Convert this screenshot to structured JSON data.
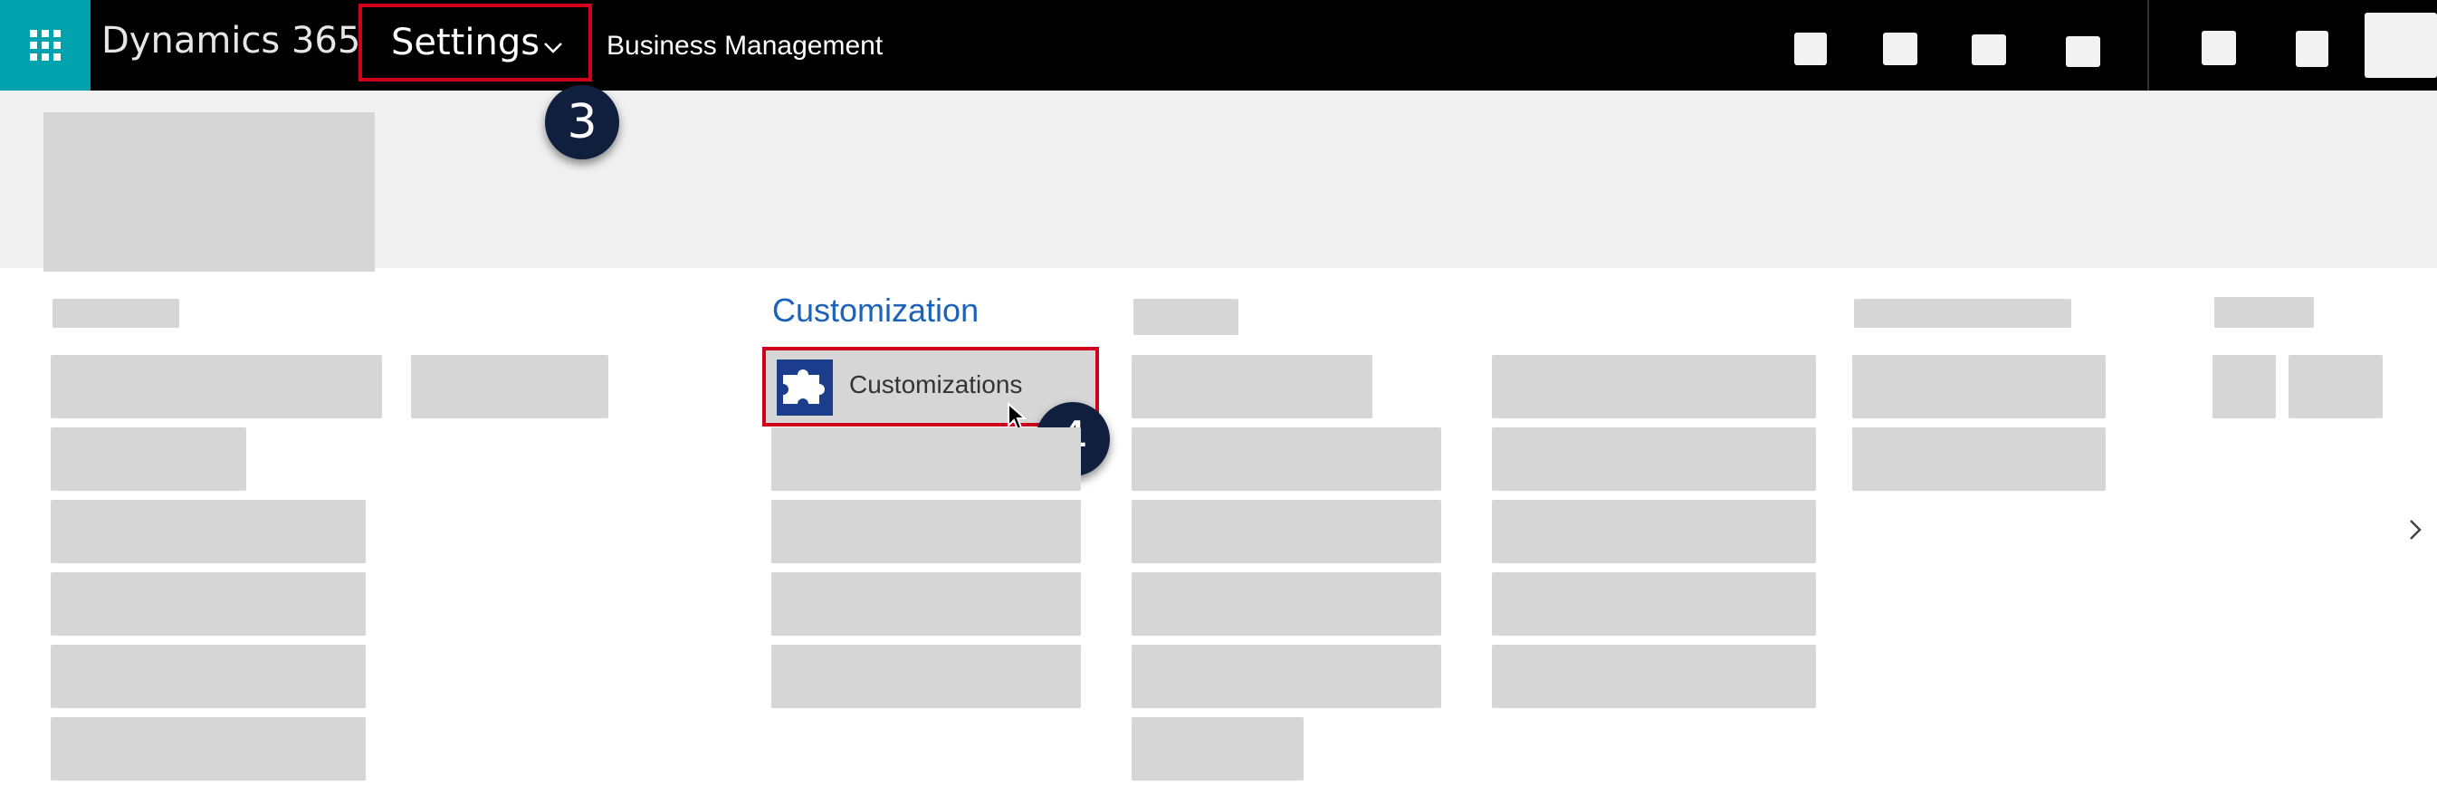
{
  "header": {
    "app_title": "Dynamics 365",
    "area_menu_label": "Settings",
    "breadcrumb": "Business Management",
    "icons": [
      "waffle-icon",
      "chevron-down-icon"
    ]
  },
  "steps": {
    "step3": "3",
    "step4": "4"
  },
  "content": {
    "section_title": "Customization",
    "item_label": "Customizations",
    "item_icon": "puzzle-icon",
    "scroll_icon": "chevron-right-icon"
  },
  "colors": {
    "topbar": "#000000",
    "waffle": "#00a2ad",
    "highlight": "#d0021b",
    "section_title": "#1b62b8",
    "badge": "#0f1f3d",
    "placeholder": "#d6d6d6"
  }
}
